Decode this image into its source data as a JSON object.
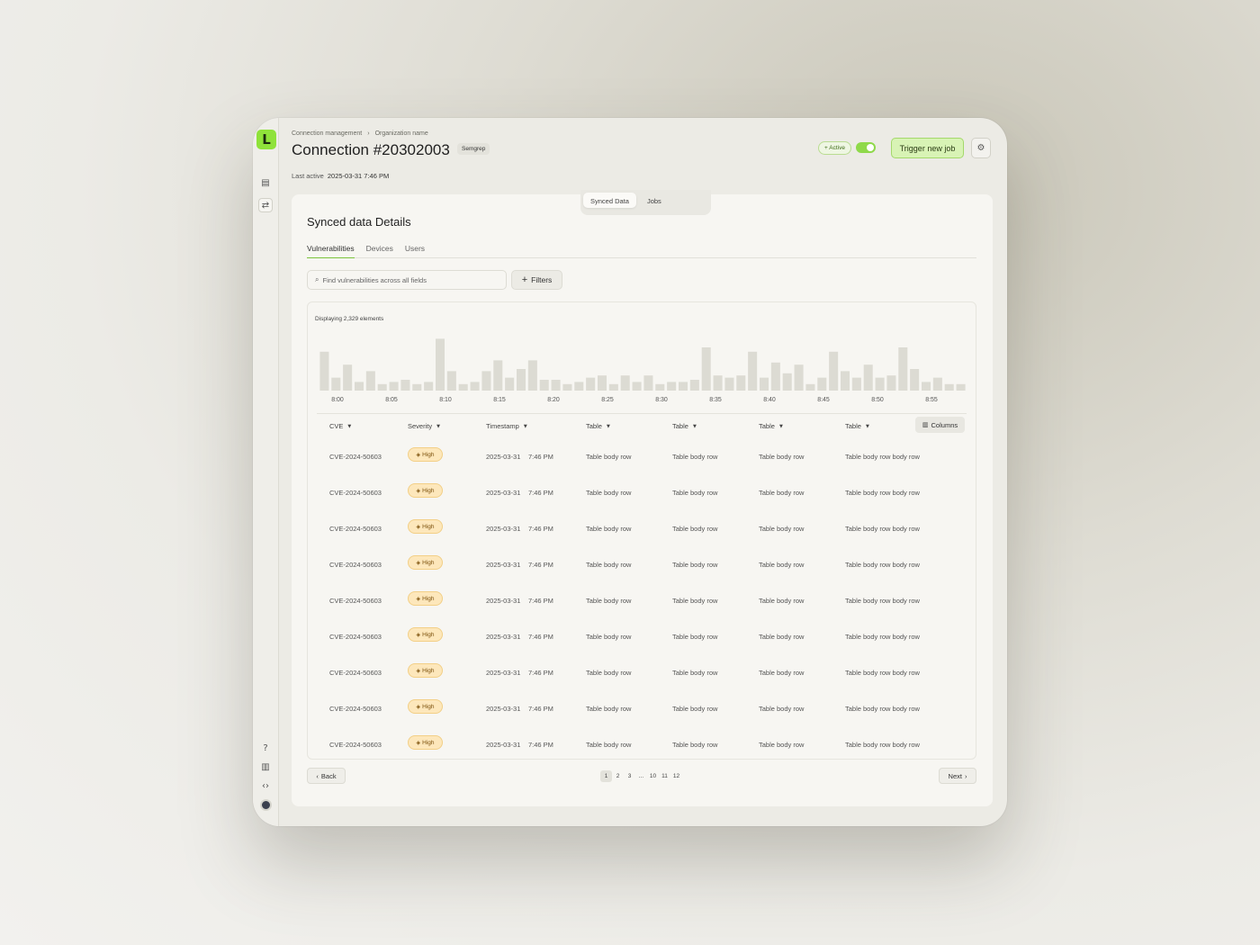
{
  "brand": {
    "logo_letter": "L",
    "accent": "#8fe23a"
  },
  "breadcrumb": [
    "Connection management",
    "Organization name"
  ],
  "header": {
    "title": "Connection #20302003",
    "tag": "Semgrep",
    "last_active_label": "Last active",
    "last_active_value": "2025-03-31  7:46 PM",
    "status": "+ Active",
    "toggle_on": true,
    "trigger_label": "Trigger new job"
  },
  "view_switch": [
    "Synced Data",
    "Jobs"
  ],
  "card": {
    "title": "Synced data Details",
    "tabs": [
      "Vulnerabilities",
      "Devices",
      "Users"
    ],
    "search_placeholder": "Find vulnerabilities across all fields",
    "filters_label": "Filters",
    "displaying": "Displaying 2,329 elements"
  },
  "chart_data": {
    "type": "bar",
    "categories": [
      "8:00",
      "8:05",
      "8:10",
      "8:15",
      "8:20",
      "8:25",
      "8:30",
      "8:35",
      "8:40",
      "8:45",
      "8:50",
      "8:55"
    ],
    "values": [
      18,
      6,
      12,
      4,
      9,
      3,
      4,
      5,
      3,
      4,
      24,
      9,
      3,
      4,
      9,
      14,
      6,
      10,
      14,
      5,
      5,
      3,
      4,
      6,
      7,
      3,
      7,
      4,
      7,
      3,
      4,
      4,
      5,
      20,
      7,
      6,
      7,
      18,
      6,
      13,
      8,
      12,
      3,
      6,
      18,
      9,
      6,
      12,
      6,
      7,
      20,
      10,
      4,
      6,
      3,
      3
    ],
    "xlabel": "",
    "ylabel": "",
    "grid": false
  },
  "table": {
    "columns": [
      "CVE",
      "Severity",
      "Timestamp",
      "Table",
      "Table",
      "Table",
      "Table"
    ],
    "columns_button": "Columns",
    "rows": [
      {
        "cve": "CVE-2024-50603",
        "severity": "High",
        "date": "2025-03-31",
        "time": "7:46 PM",
        "c1": "Table body row",
        "c2": "Table body row",
        "c3": "Table body row",
        "c4": "Table body row  body row"
      },
      {
        "cve": "CVE-2024-50603",
        "severity": "High",
        "date": "2025-03-31",
        "time": "7:46 PM",
        "c1": "Table body row",
        "c2": "Table body row",
        "c3": "Table body row",
        "c4": "Table body row  body row"
      },
      {
        "cve": "CVE-2024-50603",
        "severity": "High",
        "date": "2025-03-31",
        "time": "7:46 PM",
        "c1": "Table body row",
        "c2": "Table body row",
        "c3": "Table body row",
        "c4": "Table body row  body row"
      },
      {
        "cve": "CVE-2024-50603",
        "severity": "High",
        "date": "2025-03-31",
        "time": "7:46 PM",
        "c1": "Table body row",
        "c2": "Table body row",
        "c3": "Table body row",
        "c4": "Table body row  body row"
      },
      {
        "cve": "CVE-2024-50603",
        "severity": "High",
        "date": "2025-03-31",
        "time": "7:46 PM",
        "c1": "Table body row",
        "c2": "Table body row",
        "c3": "Table body row",
        "c4": "Table body row  body row"
      },
      {
        "cve": "CVE-2024-50603",
        "severity": "High",
        "date": "2025-03-31",
        "time": "7:46 PM",
        "c1": "Table body row",
        "c2": "Table body row",
        "c3": "Table body row",
        "c4": "Table body row  body row"
      },
      {
        "cve": "CVE-2024-50603",
        "severity": "High",
        "date": "2025-03-31",
        "time": "7:46 PM",
        "c1": "Table body row",
        "c2": "Table body row",
        "c3": "Table body row",
        "c4": "Table body row  body row"
      },
      {
        "cve": "CVE-2024-50603",
        "severity": "High",
        "date": "2025-03-31",
        "time": "7:46 PM",
        "c1": "Table body row",
        "c2": "Table body row",
        "c3": "Table body row",
        "c4": "Table body row  body row"
      },
      {
        "cve": "CVE-2024-50603",
        "severity": "High",
        "date": "2025-03-31",
        "time": "7:46 PM",
        "c1": "Table body row",
        "c2": "Table body row",
        "c3": "Table body row",
        "c4": "Table body row  body row"
      }
    ]
  },
  "pagination": {
    "back_label": "Back",
    "next_label": "Next",
    "pages": [
      "1",
      "2",
      "3",
      "...",
      "10",
      "11",
      "12"
    ],
    "current": "1"
  },
  "icons": {
    "sidebar": [
      "dashboard-icon",
      "sync-icon",
      "help-icon",
      "docs-icon",
      "code-icon"
    ],
    "header": [
      "gear-icon"
    ]
  }
}
